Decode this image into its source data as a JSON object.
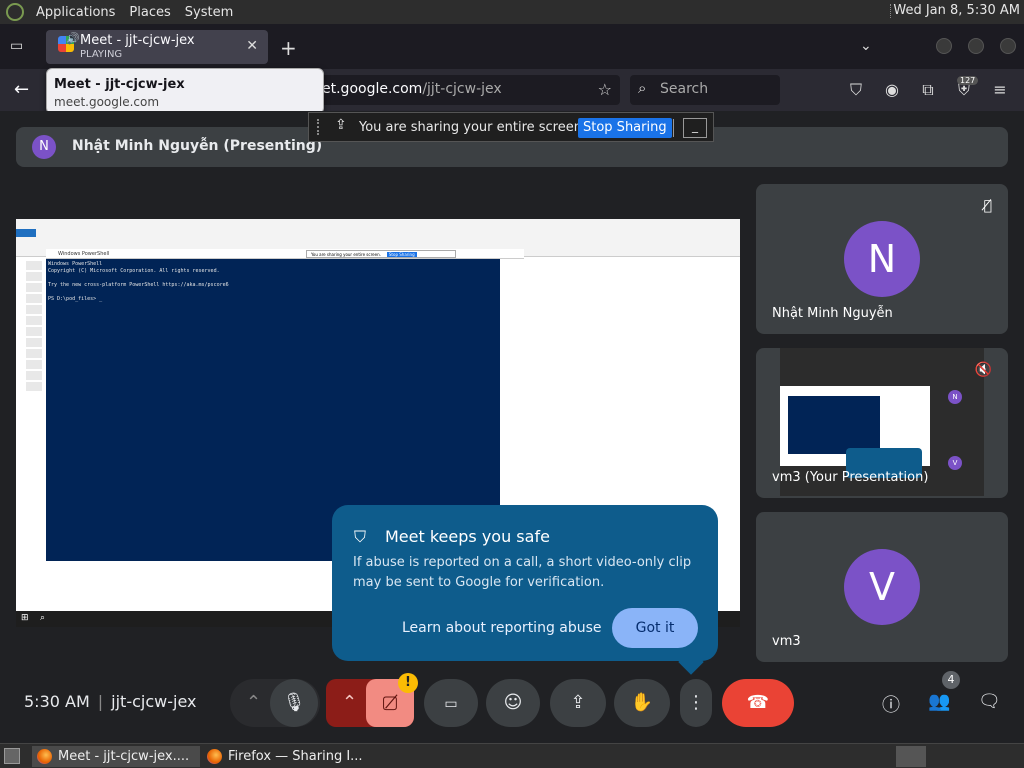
{
  "panel": {
    "applications": "Applications",
    "places": "Places",
    "system": "System",
    "clock": "Wed Jan  8,  5:30 AM"
  },
  "browser": {
    "tab_title": "Meet - jjt-cjcw-jex",
    "tab_status": "PLAYING",
    "url_prefix": "et.google.com",
    "url_path": "/jjt-cjcw-jex",
    "search_placeholder": "Search",
    "badge_count": "127"
  },
  "tooltip": {
    "title": "Meet - jjt-cjcw-jex",
    "url": "meet.google.com"
  },
  "sharebar": {
    "message": "You are sharing your entire screen.",
    "stop": "Stop Sharing",
    "minimize": "_"
  },
  "meet": {
    "presenter_initial": "N",
    "presenter_label": "Nhật Minh Nguyễn (Presenting)",
    "tiles": [
      {
        "initial": "N",
        "name": "Nhật Minh Nguyễn"
      },
      {
        "name": "vm3 (Your Presentation)"
      },
      {
        "initial": "V",
        "name": "vm3"
      }
    ],
    "time": "5:30 AM",
    "meeting_code": "jjt-cjcw-jex",
    "people_count": "4",
    "warning": "!"
  },
  "shared_screen": {
    "ps_title": "Windows PowerShell",
    "ps_lines": [
      "Windows PowerShell",
      "Copyright (C) Microsoft Corporation. All rights reserved.",
      "",
      "Try the new cross-platform PowerShell https://aka.ms/pscore6",
      "",
      "PS D:\\pod_files> _"
    ],
    "share_msg": "You are sharing your entire screen.",
    "share_stop": "Stop Sharing"
  },
  "safety": {
    "title": "Meet keeps you safe",
    "body": "If abuse is reported on a call, a short video-only clip may be sent to Google for verification.",
    "learn": "Learn about reporting abuse",
    "got_it": "Got it"
  },
  "taskbar": {
    "task1": "Meet - jjt-cjcw-jex....",
    "task2": "Firefox — Sharing I..."
  },
  "colors": {
    "meet_bg": "#202124",
    "tile_bg": "#3c4043",
    "avatar": "#7b52c7",
    "end_call": "#ea4335",
    "tooltip_blue": "#0e5c8c",
    "got_it": "#8ab4f8",
    "stop_sharing": "#1a73e8"
  }
}
